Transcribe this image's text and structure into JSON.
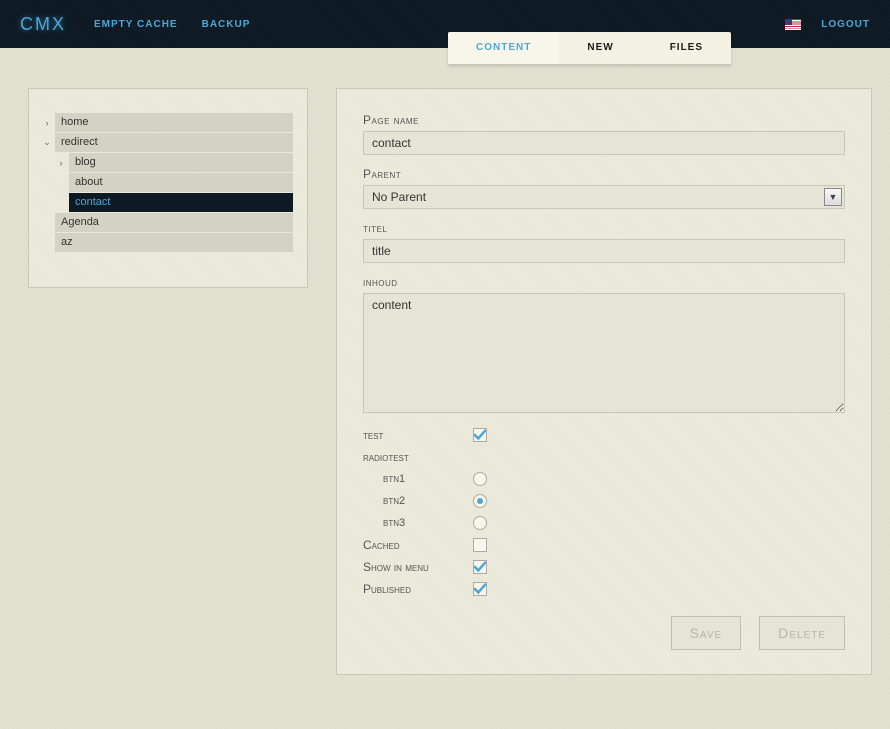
{
  "brand": "CMX",
  "header": {
    "empty_cache": "EMPTY CACHE",
    "backup": "BACKUP",
    "logout": "LOGOUT"
  },
  "tabs": {
    "content": "CONTENT",
    "new": "NEW",
    "files": "FILES"
  },
  "tree": {
    "items": [
      {
        "label": "home",
        "depth": 0,
        "arrow": "right",
        "active": false
      },
      {
        "label": "redirect",
        "depth": 0,
        "arrow": "down",
        "active": false
      },
      {
        "label": "blog",
        "depth": 1,
        "arrow": "right",
        "active": false
      },
      {
        "label": "about",
        "depth": 1,
        "arrow": "none",
        "active": false
      },
      {
        "label": "contact",
        "depth": 1,
        "arrow": "none",
        "active": true
      },
      {
        "label": "Agenda",
        "depth": 0,
        "arrow": "none",
        "active": false
      },
      {
        "label": "az",
        "depth": 0,
        "arrow": "none",
        "active": false
      }
    ]
  },
  "form": {
    "page_name_label": "Page name",
    "page_name_value": "contact",
    "parent_label": "Parent",
    "parent_value": "No Parent",
    "titel_label": "titel",
    "titel_value": "title",
    "inhoud_label": "inhoud",
    "inhoud_value": "content",
    "test_label": "test",
    "test_checked": true,
    "radiotest_label": "radiotest",
    "radios": {
      "btn1_label": "btn1",
      "btn2_label": "btn2",
      "btn3_label": "btn3",
      "selected": "btn2"
    },
    "cached_label": "Cached",
    "cached_checked": false,
    "show_in_menu_label": "Show in menu",
    "show_in_menu_checked": true,
    "published_label": "Published",
    "published_checked": true,
    "save_label": "Save",
    "delete_label": "Delete"
  }
}
